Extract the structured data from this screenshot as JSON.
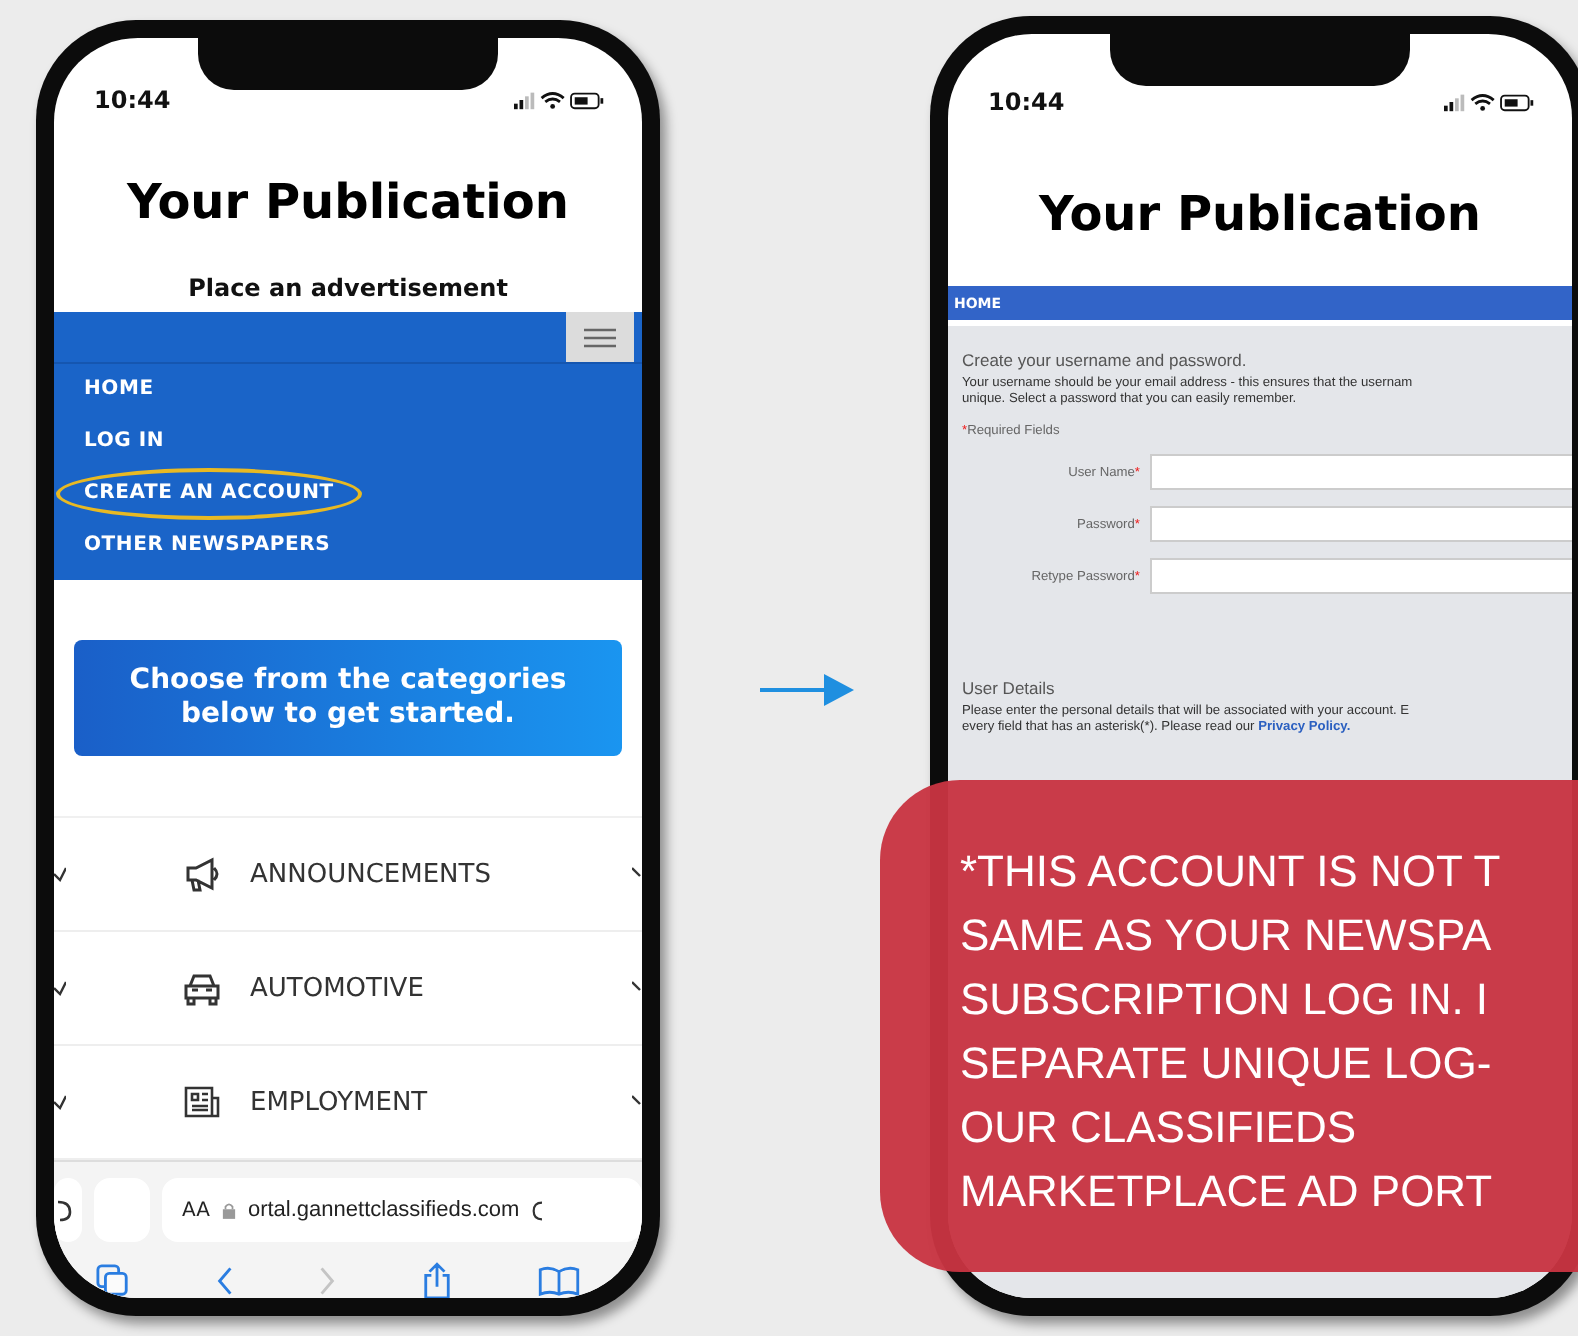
{
  "left_phone": {
    "time": "10:44",
    "title": "Your Publication",
    "subtitle": "Place an advertisement",
    "nav_items": [
      {
        "label": "HOME",
        "circled": false
      },
      {
        "label": "LOG IN",
        "circled": false
      },
      {
        "label": "CREATE AN ACCOUNT",
        "circled": true
      },
      {
        "label": "OTHER NEWSPAPERS",
        "circled": false
      }
    ],
    "banner": "Choose from the categories below to get started.",
    "categories": [
      {
        "label": "ANNOUNCEMENTS",
        "kind": "megaphone"
      },
      {
        "label": "AUTOMOTIVE",
        "kind": "car"
      },
      {
        "label": "EMPLOYMENT",
        "kind": "newspaper"
      }
    ],
    "address_bar": {
      "text_size": "AA",
      "url": "ortal.gannettclassifieds.com"
    },
    "toolbar": [
      {
        "kind": "tabs",
        "disabled": false
      },
      {
        "kind": "back",
        "disabled": false
      },
      {
        "kind": "forward",
        "disabled": true
      },
      {
        "kind": "share",
        "disabled": false
      },
      {
        "kind": "bookmarks",
        "disabled": false
      }
    ]
  },
  "right_phone": {
    "time": "10:44",
    "title": "Your Publication",
    "nav_items": [
      {
        "label": "HOME"
      }
    ],
    "heading": "Create your username and password.",
    "intro_lines": [
      "Your username should be your email address - this ensures that the usernam",
      "unique. Select a password that you can easily remember."
    ],
    "required_note": {
      "marker": "*",
      "text": "Required Fields"
    },
    "fields": [
      {
        "label": "User Name",
        "marker": "*"
      },
      {
        "label": "Password",
        "marker": "*"
      },
      {
        "label": "Retype Password",
        "marker": "*"
      }
    ],
    "section_heading": "User Details",
    "section_lines": [
      "Please enter the personal details that will be associated with your account. E",
      "every field that has an asterisk(*). Please read our"
    ],
    "privacy_link": "Privacy Policy."
  },
  "notice": {
    "lines": [
      "*THIS ACCOUNT IS NOT T",
      "SAME AS YOUR NEWSPA",
      "SUBSCRIPTION LOG IN. I",
      "SEPARATE UNIQUE LOG-",
      "OUR CLASSIFIEDS",
      "MARKETPLACE AD PORT"
    ]
  }
}
